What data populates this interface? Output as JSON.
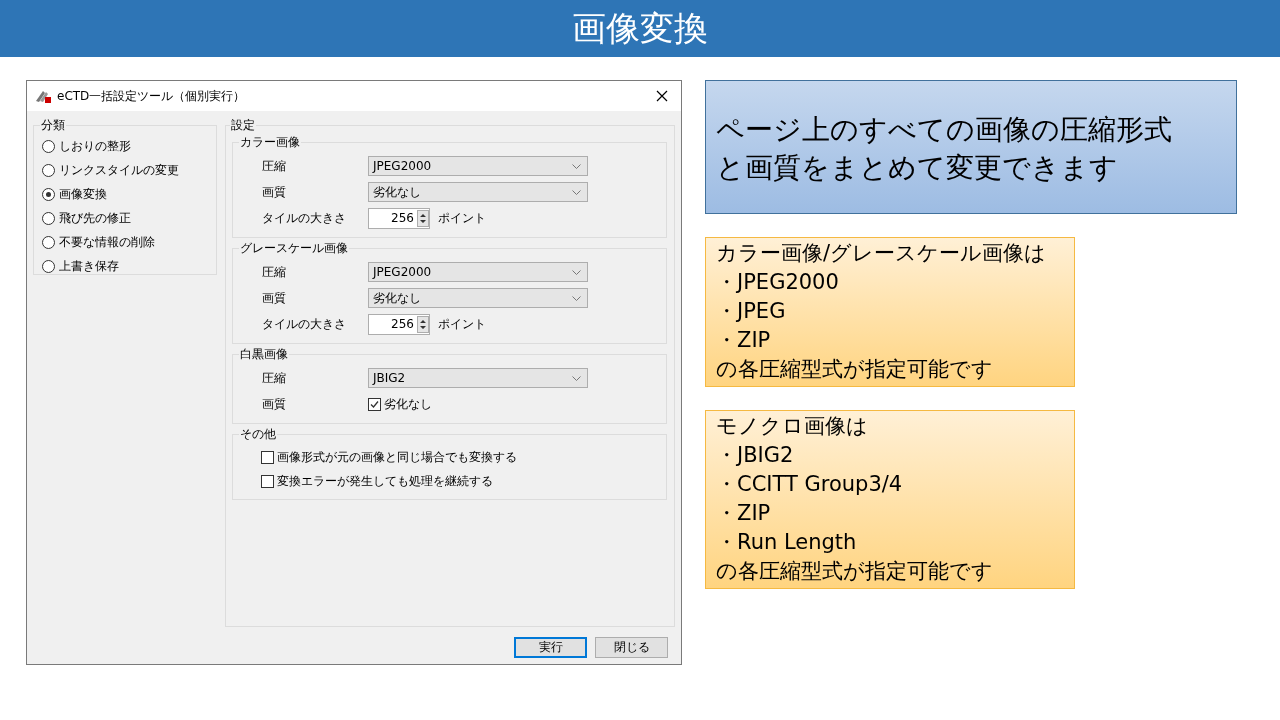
{
  "slide_title": "画像変換",
  "dialog": {
    "title": "eCTD一括設定ツール（個別実行）",
    "category": {
      "label": "分類",
      "options": [
        {
          "label": "しおりの整形",
          "selected": false
        },
        {
          "label": "リンクスタイルの変更",
          "selected": false
        },
        {
          "label": "画像変換",
          "selected": true
        },
        {
          "label": "飛び先の修正",
          "selected": false
        },
        {
          "label": "不要な情報の削除",
          "selected": false
        },
        {
          "label": "上書き保存",
          "selected": false
        }
      ]
    },
    "settings": {
      "label": "設定",
      "groups": [
        {
          "label": "カラー画像",
          "rows": [
            {
              "kind": "select",
              "label": "圧縮",
              "value": "JPEG2000"
            },
            {
              "kind": "select",
              "label": "画質",
              "value": "劣化なし"
            },
            {
              "kind": "spinner",
              "label": "タイルの大きさ",
              "value": "256",
              "unit": "ポイント"
            }
          ]
        },
        {
          "label": "グレースケール画像",
          "rows": [
            {
              "kind": "select",
              "label": "圧縮",
              "value": "JPEG2000"
            },
            {
              "kind": "select",
              "label": "画質",
              "value": "劣化なし"
            },
            {
              "kind": "spinner",
              "label": "タイルの大きさ",
              "value": "256",
              "unit": "ポイント"
            }
          ]
        },
        {
          "label": "白黒画像",
          "rows": [
            {
              "kind": "select",
              "label": "圧縮",
              "value": "JBIG2"
            },
            {
              "kind": "checkbox",
              "label": "画質",
              "text": "劣化なし",
              "checked": true
            }
          ]
        },
        {
          "label": "その他",
          "rows": [
            {
              "kind": "checkbox",
              "text": "画像形式が元の画像と同じ場合でも変換する",
              "checked": false
            },
            {
              "kind": "checkbox",
              "text": "変換エラーが発生しても処理を継続する",
              "checked": false
            }
          ]
        }
      ]
    },
    "buttons": [
      {
        "label": "実行",
        "default": true
      },
      {
        "label": "閉じる",
        "default": false
      }
    ]
  },
  "callouts": [
    {
      "kind": "blue",
      "lines": [
        "ページ上のすべての画像の圧縮形式",
        "と画質をまとめて変更できます"
      ]
    },
    {
      "kind": "orange",
      "lines": [
        "カラー画像/グレースケール画像は",
        "・JPEG2000",
        "・JPEG",
        "・ZIP",
        "の各圧縮型式が指定可能です"
      ]
    },
    {
      "kind": "orange",
      "lines": [
        "モノクロ画像は",
        "・JBIG2",
        "・CCITT Group3/4",
        "・ZIP",
        "・Run Length",
        "の各圧縮型式が指定可能です"
      ]
    }
  ]
}
